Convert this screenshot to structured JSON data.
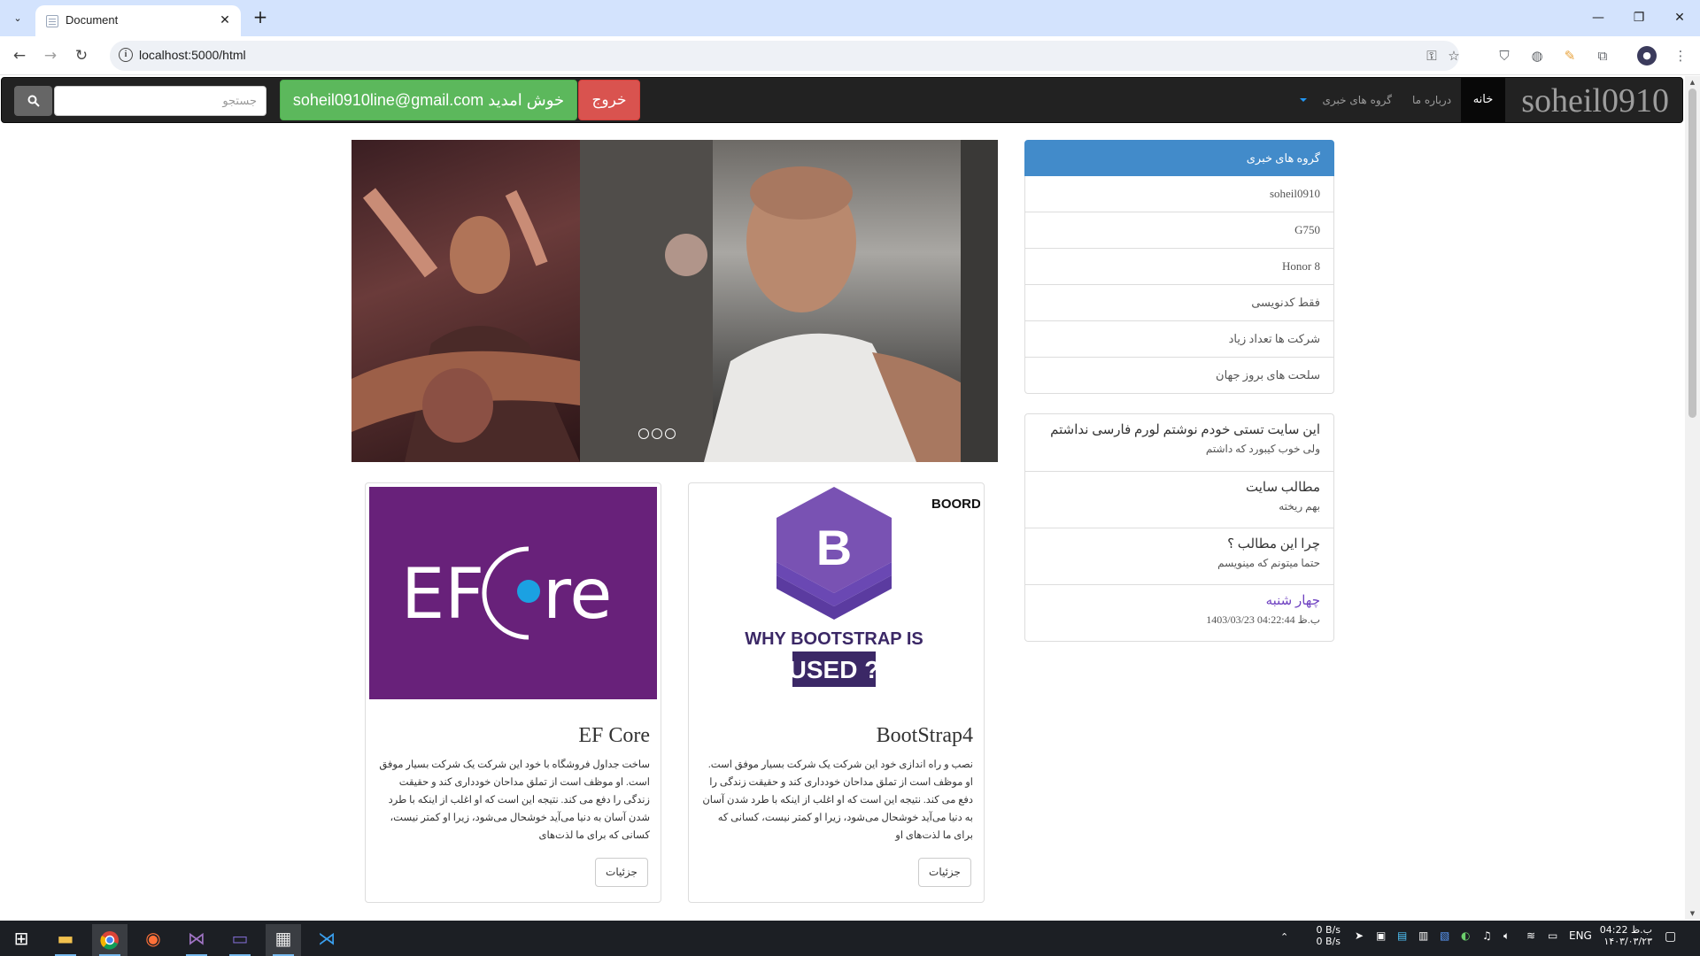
{
  "browser": {
    "tab_title": "Document",
    "url": "localhost:5000/html",
    "new_tab": "+",
    "close": "✕",
    "minimize": "—",
    "restore": "❐",
    "window_close": "✕"
  },
  "navbar": {
    "brand": "soheil0910",
    "home": "خانه",
    "about": "درباره ما",
    "groups": "گروه های خبری",
    "logout": "خروج",
    "welcome": "soheil0910line@gmail.com خوش امدید",
    "search_placeholder": "جستجو"
  },
  "groups": {
    "header": "گروه های خبری",
    "items": [
      "soheil0910",
      "G750",
      "Honor 8",
      "فقط کدنویسی",
      "شرکت ها تعداد زیاد",
      "سلحت های بروز جهان"
    ]
  },
  "info": [
    {
      "title": "این سایت تستی خودم نوشتم لورم فارسی نداشتم",
      "sub": "ولی خوب کیبورد که داشتم"
    },
    {
      "title": "مطالب سایت",
      "sub": "بهم ریخته"
    },
    {
      "title": "چرا این مطالب ؟",
      "sub": "حتما میتونم که مینویسم"
    },
    {
      "title": "چهار شنبه",
      "sub": "1403/03/23 04:22:44 ب.ظ"
    }
  ],
  "cards": [
    {
      "title": "BootStrap4",
      "text": "نصب و راه اندازی خود این شرکت یک شرکت بسیار موفق است. او موظف است از تملق مداحان خودداری کند و حقیقت زندگی را دفع می کند. نتیجه این است که او اغلب از اینکه با طرد شدن آسان به دنیا می‌آید خوشحال می‌شود، زیرا او کمتر نیست، کسانی که برای ما لذت‌های او",
      "button": "جزئیات",
      "img_brand": "BOORD",
      "img_line1": "WHY BOOTSTRAP IS",
      "img_line2": "USED ?"
    },
    {
      "title": "EF Core",
      "text": "ساخت جداول فروشگاه با خود این شرکت یک شرکت بسیار موفق است. او موظف است از تملق مداحان خودداری کند و حقیقت زندگی را دفع می کند. نتیجه این است که او اغلب از اینکه با طرد شدن آسان به دنیا می‌آید خوشحال می‌شود، زیرا او کمتر نیست، کسانی که برای ما لذت‌های",
      "button": "جزئیات",
      "img_text": "EF Core"
    }
  ],
  "taskbar": {
    "net_up": "0 B/s",
    "net_down": "0 B/s",
    "lang": "ENG",
    "time": "04:22 ب.ظ",
    "date": "۱۴۰۳/۰۳/۲۳"
  },
  "colors": {
    "navbar_bg": "#222222",
    "logout": "#d9534f",
    "welcome": "#5cb85c",
    "list_active": "#428bca",
    "ef_purple": "#68217a",
    "bootstrap_purple": "#7952b3"
  }
}
